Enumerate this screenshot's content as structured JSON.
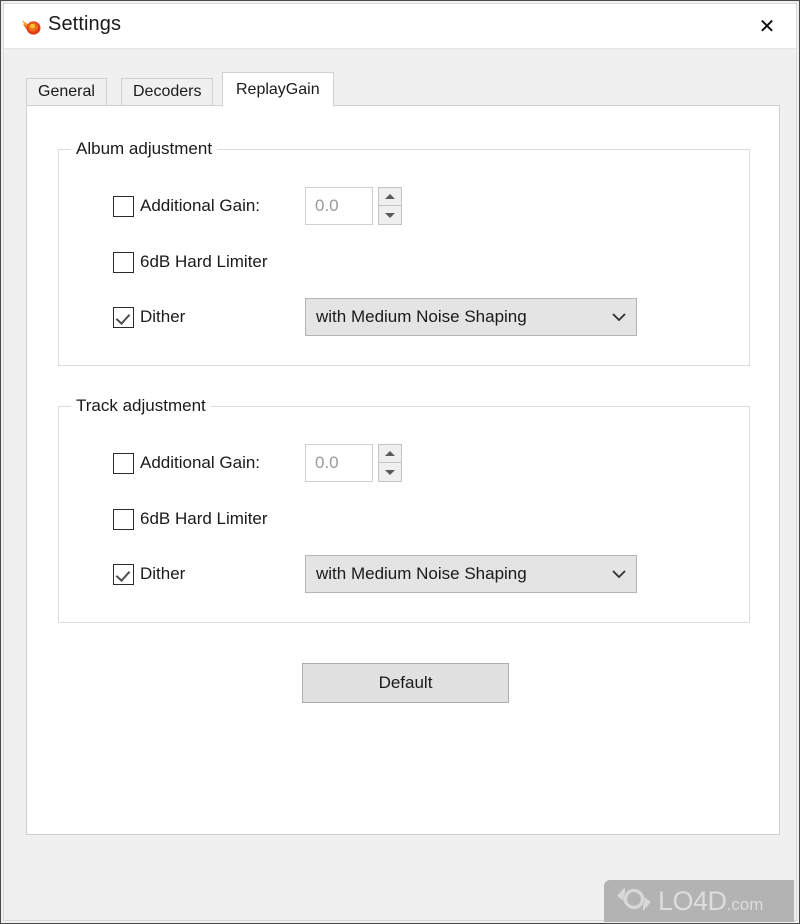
{
  "window": {
    "title": "Settings",
    "icon": "flame-comet-icon",
    "close_label": "✕"
  },
  "tabs": [
    {
      "label": "General",
      "active": false
    },
    {
      "label": "Decoders",
      "active": false
    },
    {
      "label": "ReplayGain",
      "active": true
    }
  ],
  "groups": [
    {
      "legend": "Album adjustment",
      "additional_gain": {
        "label": "Additional Gain:",
        "checked": false,
        "value": "0.0",
        "placeholder": "0.0"
      },
      "hard_limiter": {
        "label": "6dB Hard Limiter",
        "checked": false
      },
      "dither": {
        "label": "Dither",
        "checked": true,
        "selected": "with Medium Noise Shaping"
      }
    },
    {
      "legend": "Track adjustment",
      "additional_gain": {
        "label": "Additional Gain:",
        "checked": false,
        "value": "0.0",
        "placeholder": "0.0"
      },
      "hard_limiter": {
        "label": "6dB Hard Limiter",
        "checked": false
      },
      "dither": {
        "label": "Dither",
        "checked": true,
        "selected": "with Medium Noise Shaping"
      }
    }
  ],
  "buttons": {
    "default_label": "Default"
  },
  "watermark": {
    "text": "LO4D",
    "suffix": ".com"
  },
  "colors": {
    "titlebar_bg": "#ffffff",
    "dialog_bg": "#f0f0f0",
    "panel_bg": "#ffffff",
    "combo_bg": "#e4e4e4",
    "button_bg": "#e1e1e1",
    "text": "#1a1a1a",
    "disabled_text": "#9a9a9a",
    "group_border": "#dcdcdc",
    "watermark_bg": "#b3b3b3"
  }
}
